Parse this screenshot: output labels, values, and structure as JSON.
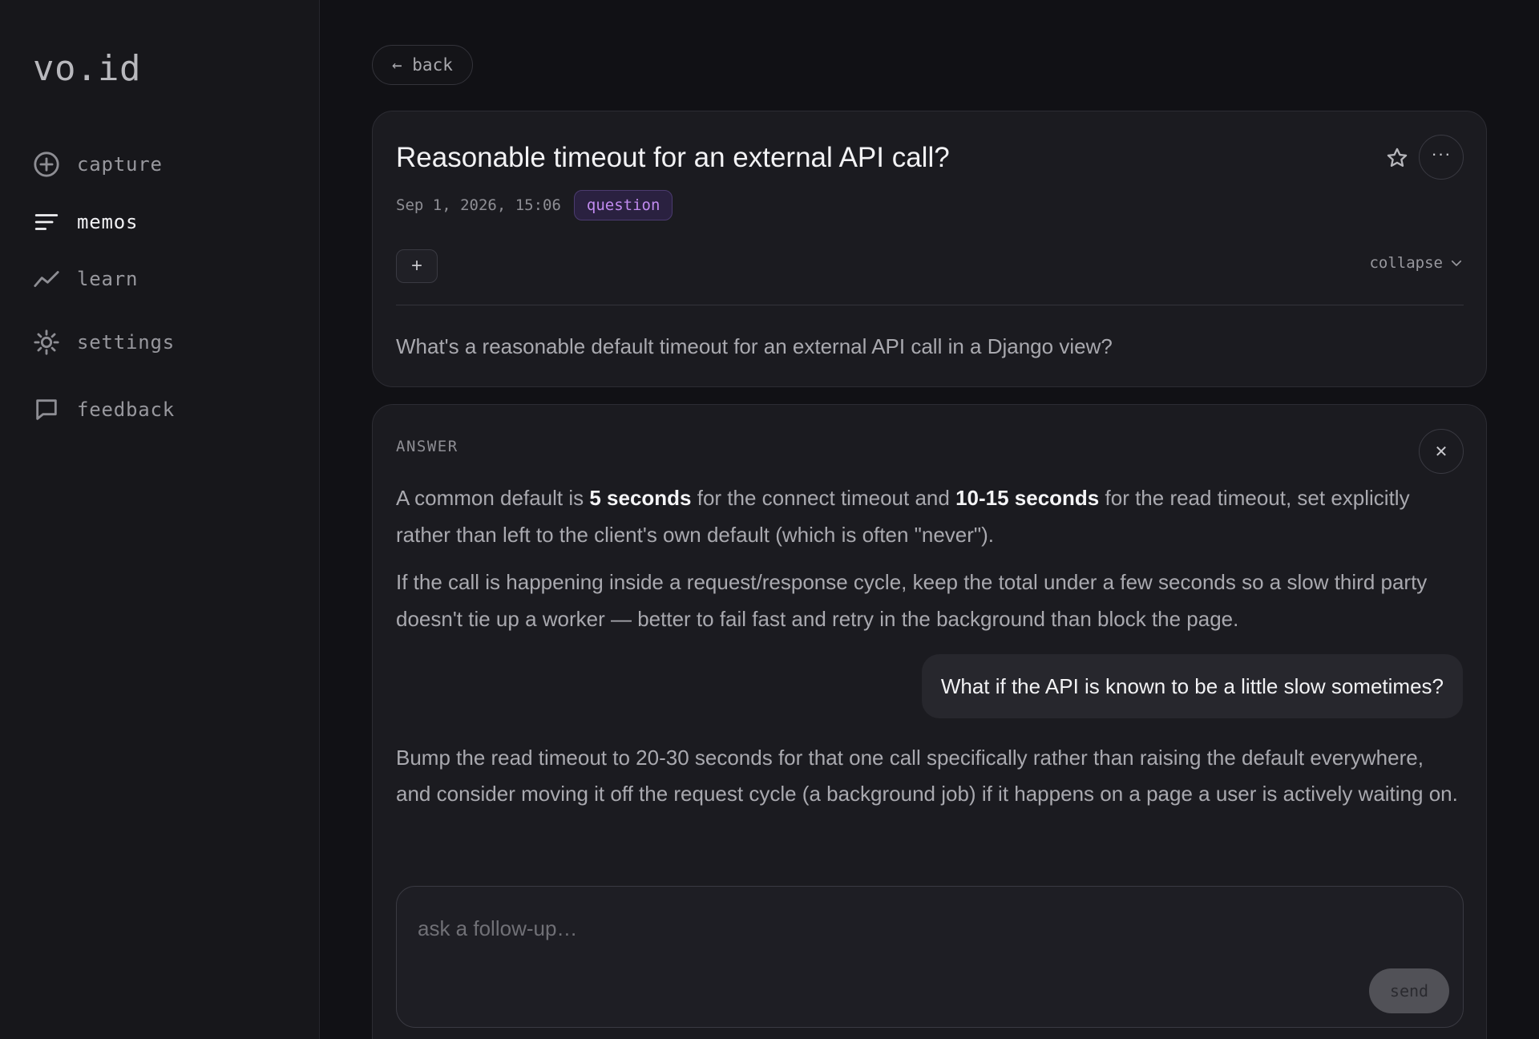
{
  "app": {
    "logo": "vo.id"
  },
  "sidebar": {
    "items": [
      {
        "label": "capture",
        "icon": "plus-circle-icon"
      },
      {
        "label": "memos",
        "icon": "lines-icon",
        "active": true
      },
      {
        "label": "learn",
        "icon": "trend-line-icon"
      },
      {
        "label": "settings",
        "icon": "sun-gear-icon"
      },
      {
        "label": "feedback",
        "icon": "chat-bubble-icon"
      }
    ]
  },
  "toolbar": {
    "back_label": "← back"
  },
  "memo": {
    "title": "Reasonable timeout for an external API call?",
    "date": "Sep 1, 2026, 15:06",
    "tag": "question",
    "add_label": "+",
    "collapse_label": "collapse",
    "body": "What's a reasonable default timeout for an external API call in a Django view?",
    "more_label": "···"
  },
  "answer": {
    "label": "ANSWER",
    "close_label": "✕",
    "p1": {
      "t1": "A common default is ",
      "b1": "5 seconds",
      "t2": " for the connect timeout and ",
      "b2": "10-15 seconds",
      "t3": " for the read timeout, set explicitly rather than left to the client's own default (which is often \"never\")."
    },
    "p2": "If the call is happening inside a request/response cycle, keep the total under a few seconds so a slow third party doesn't tie up a worker — better to fail fast and retry in the background than block the page.",
    "user_followup": "What if the API is known to be a little slow sometimes?",
    "p3": "Bump the read timeout to 20-30 seconds for that one call specifically rather than raising the default everywhere, and consider moving it off the request cycle (a background job) if it happens on a page a user is actively waiting on."
  },
  "followup": {
    "placeholder": "ask a follow-up…",
    "send_label": "send"
  }
}
